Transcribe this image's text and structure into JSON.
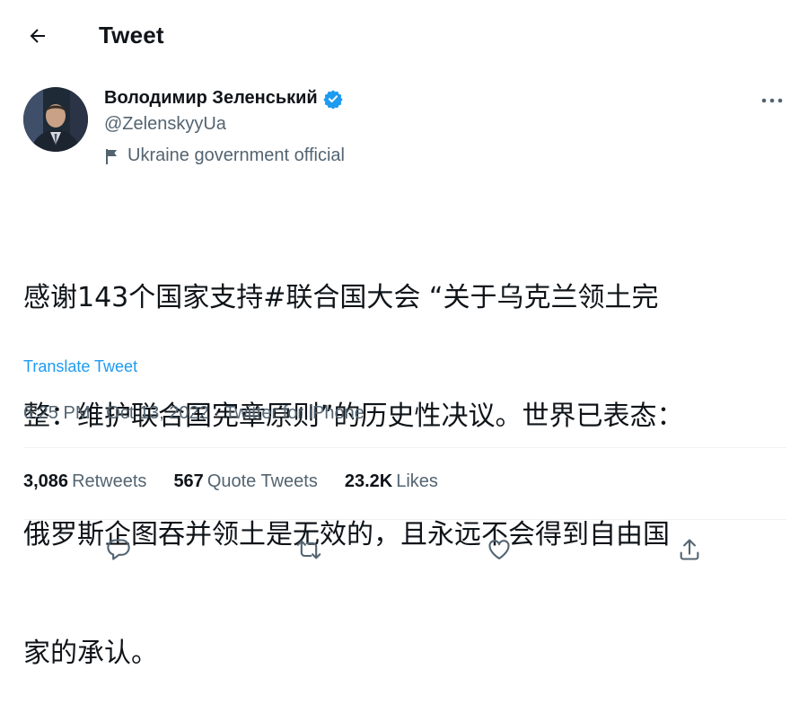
{
  "header": {
    "title": "Tweet",
    "back_icon": "arrow-left-icon"
  },
  "author": {
    "display_name": "Володимир Зеленський",
    "handle": "@ZelenskyyUa",
    "verified_icon": "verified-badge-icon",
    "label": "Ukraine government official",
    "label_icon": "flag-icon"
  },
  "tweet": {
    "text": "感谢143个国家支持#联合国大会 “关于乌克兰领土完整：维护联合国宪章原则”的历史性决议。世界已表态：俄罗斯企图吞并领土是无效的，且永远不会得到自由国家的承认。",
    "lines": [
      "感谢143个国家支持#联合国大会 “关于乌克兰领土完",
      "整：维护联合国宪章原则”的历史性决议。世界已表态：",
      "俄罗斯企图吞并领土是无效的，且永远不会得到自由国",
      "家的承认。"
    ],
    "translate_label": "Translate Tweet",
    "time": "6:25 PM",
    "date": "Oct 13, 2022",
    "source": "Twitter for iPhone",
    "separator": "·"
  },
  "stats": {
    "retweets_count": "3,086",
    "retweets_label": "Retweets",
    "quotes_count": "567",
    "quotes_label": "Quote Tweets",
    "likes_count": "23.2K",
    "likes_label": "Likes"
  },
  "actions": [
    "reply-icon",
    "retweet-icon",
    "like-icon",
    "share-icon"
  ],
  "colors": {
    "accent": "#1d9bf0",
    "text": "#0f1419",
    "secondary": "#536471",
    "divider": "#eff3f4"
  }
}
